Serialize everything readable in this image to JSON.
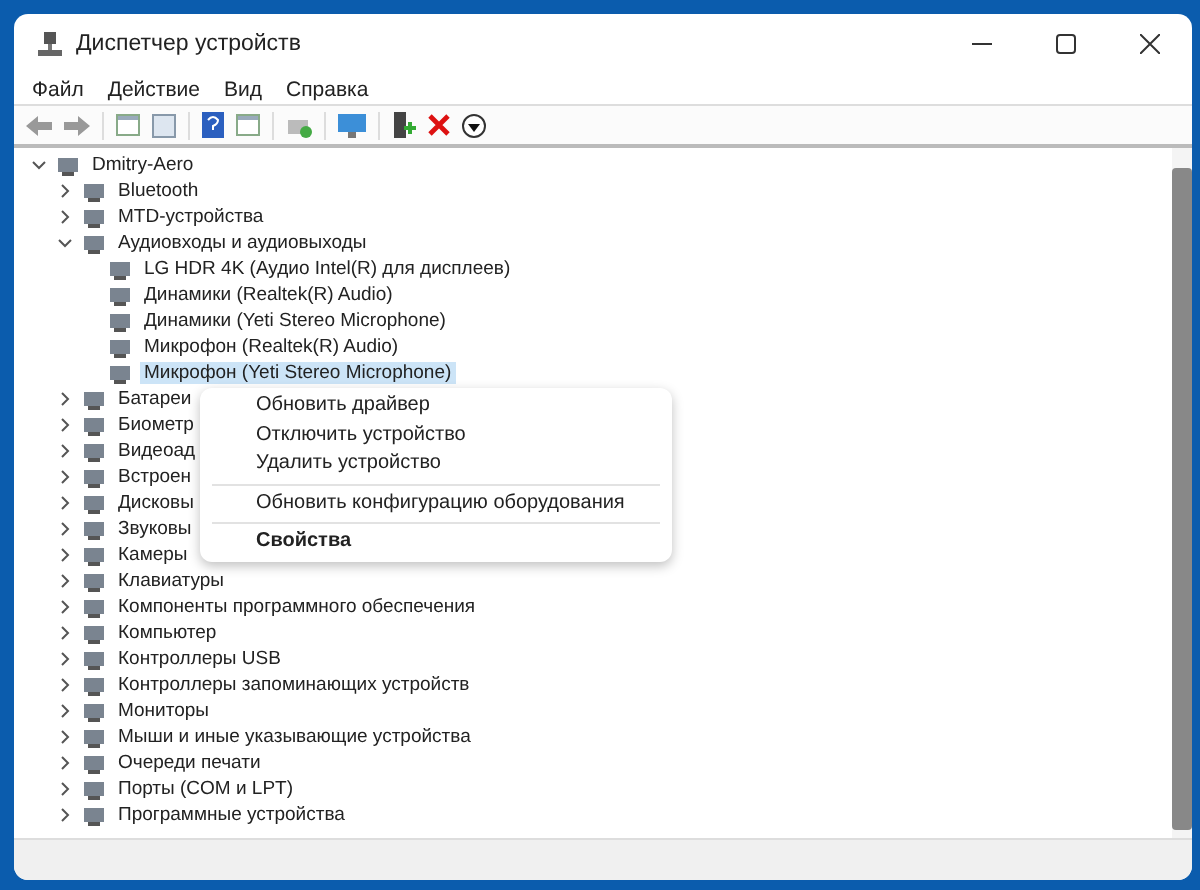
{
  "window": {
    "title": "Диспетчер устройств"
  },
  "menu": [
    "Файл",
    "Действие",
    "Вид",
    "Справка"
  ],
  "tree": [
    {
      "label": "Dmitry-Aero",
      "expanded": true,
      "selected": false,
      "children": [
        {
          "label": "Bluetooth",
          "expanded": false,
          "selected": false
        },
        {
          "label": "MTD-устройства",
          "expanded": false,
          "selected": false
        },
        {
          "label": "Аудиовходы и аудиовыходы",
          "expanded": true,
          "selected": false,
          "children": [
            {
              "label": "LG HDR 4K (Аудио Intel(R) для дисплеев)",
              "selected": false
            },
            {
              "label": "Динамики (Realtek(R) Audio)",
              "selected": false
            },
            {
              "label": "Динамики (Yeti Stereo Microphone)",
              "selected": false
            },
            {
              "label": "Микрофон (Realtek(R) Audio)",
              "selected": false
            },
            {
              "label": "Микрофон (Yeti Stereo Microphone)",
              "selected": true
            }
          ]
        },
        {
          "label": "Батареи",
          "expanded": false,
          "selected": false
        },
        {
          "label": "Биометр",
          "expanded": false,
          "selected": false
        },
        {
          "label": "Видеоад",
          "expanded": false,
          "selected": false
        },
        {
          "label": "Встроен",
          "expanded": false,
          "selected": false
        },
        {
          "label": "Дисковы",
          "expanded": false,
          "selected": false
        },
        {
          "label": "Звуковы",
          "expanded": false,
          "selected": false
        },
        {
          "label": "Камеры",
          "expanded": false,
          "selected": false
        },
        {
          "label": "Клавиатуры",
          "expanded": false,
          "selected": false
        },
        {
          "label": "Компоненты программного обеспечения",
          "expanded": false,
          "selected": false
        },
        {
          "label": "Компьютер",
          "expanded": false,
          "selected": false
        },
        {
          "label": "Контроллеры USB",
          "expanded": false,
          "selected": false
        },
        {
          "label": "Контроллеры запоминающих устройств",
          "expanded": false,
          "selected": false
        },
        {
          "label": "Мониторы",
          "expanded": false,
          "selected": false
        },
        {
          "label": "Мыши и иные указывающие устройства",
          "expanded": false,
          "selected": false
        },
        {
          "label": "Очереди печати",
          "expanded": false,
          "selected": false
        },
        {
          "label": "Порты (COM и LPT)",
          "expanded": false,
          "selected": false
        },
        {
          "label": "Программные устройства",
          "expanded": false,
          "selected": false
        }
      ]
    }
  ],
  "context_menu": [
    {
      "label": "Обновить драйвер",
      "separator_before": false,
      "default": false
    },
    {
      "label": "Отключить устройство",
      "separator_before": false,
      "default": false
    },
    {
      "label": "Удалить устройство",
      "separator_before": false,
      "default": false
    },
    {
      "label": "Обновить конфигурацию оборудования",
      "separator_before": true,
      "default": false
    },
    {
      "label": "Свойства",
      "separator_before": true,
      "default": true
    }
  ]
}
